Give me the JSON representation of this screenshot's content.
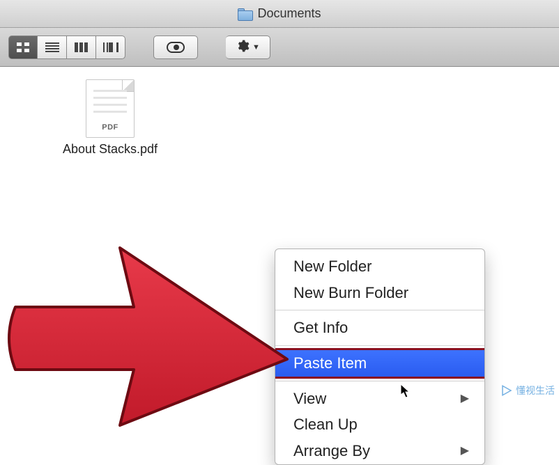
{
  "window": {
    "title": "Documents"
  },
  "toolbar": {
    "views": [
      "icon",
      "list",
      "column",
      "coverflow"
    ],
    "labels": {
      "preview": "Quick Look",
      "action": "Action"
    }
  },
  "file": {
    "name": "About Stacks.pdf",
    "badge": "PDF"
  },
  "context_menu": {
    "items": [
      {
        "label": "New Folder",
        "submenu": false
      },
      {
        "label": "New Burn Folder",
        "submenu": false
      }
    ],
    "items2": [
      {
        "label": "Get Info",
        "submenu": false
      }
    ],
    "highlight": {
      "label": "Paste Item"
    },
    "items3": [
      {
        "label": "View",
        "submenu": true
      },
      {
        "label": "Clean Up",
        "submenu": false
      },
      {
        "label": "Arrange By",
        "submenu": true
      }
    ]
  },
  "watermark": {
    "brand": "懂视生活",
    "sub": ""
  }
}
